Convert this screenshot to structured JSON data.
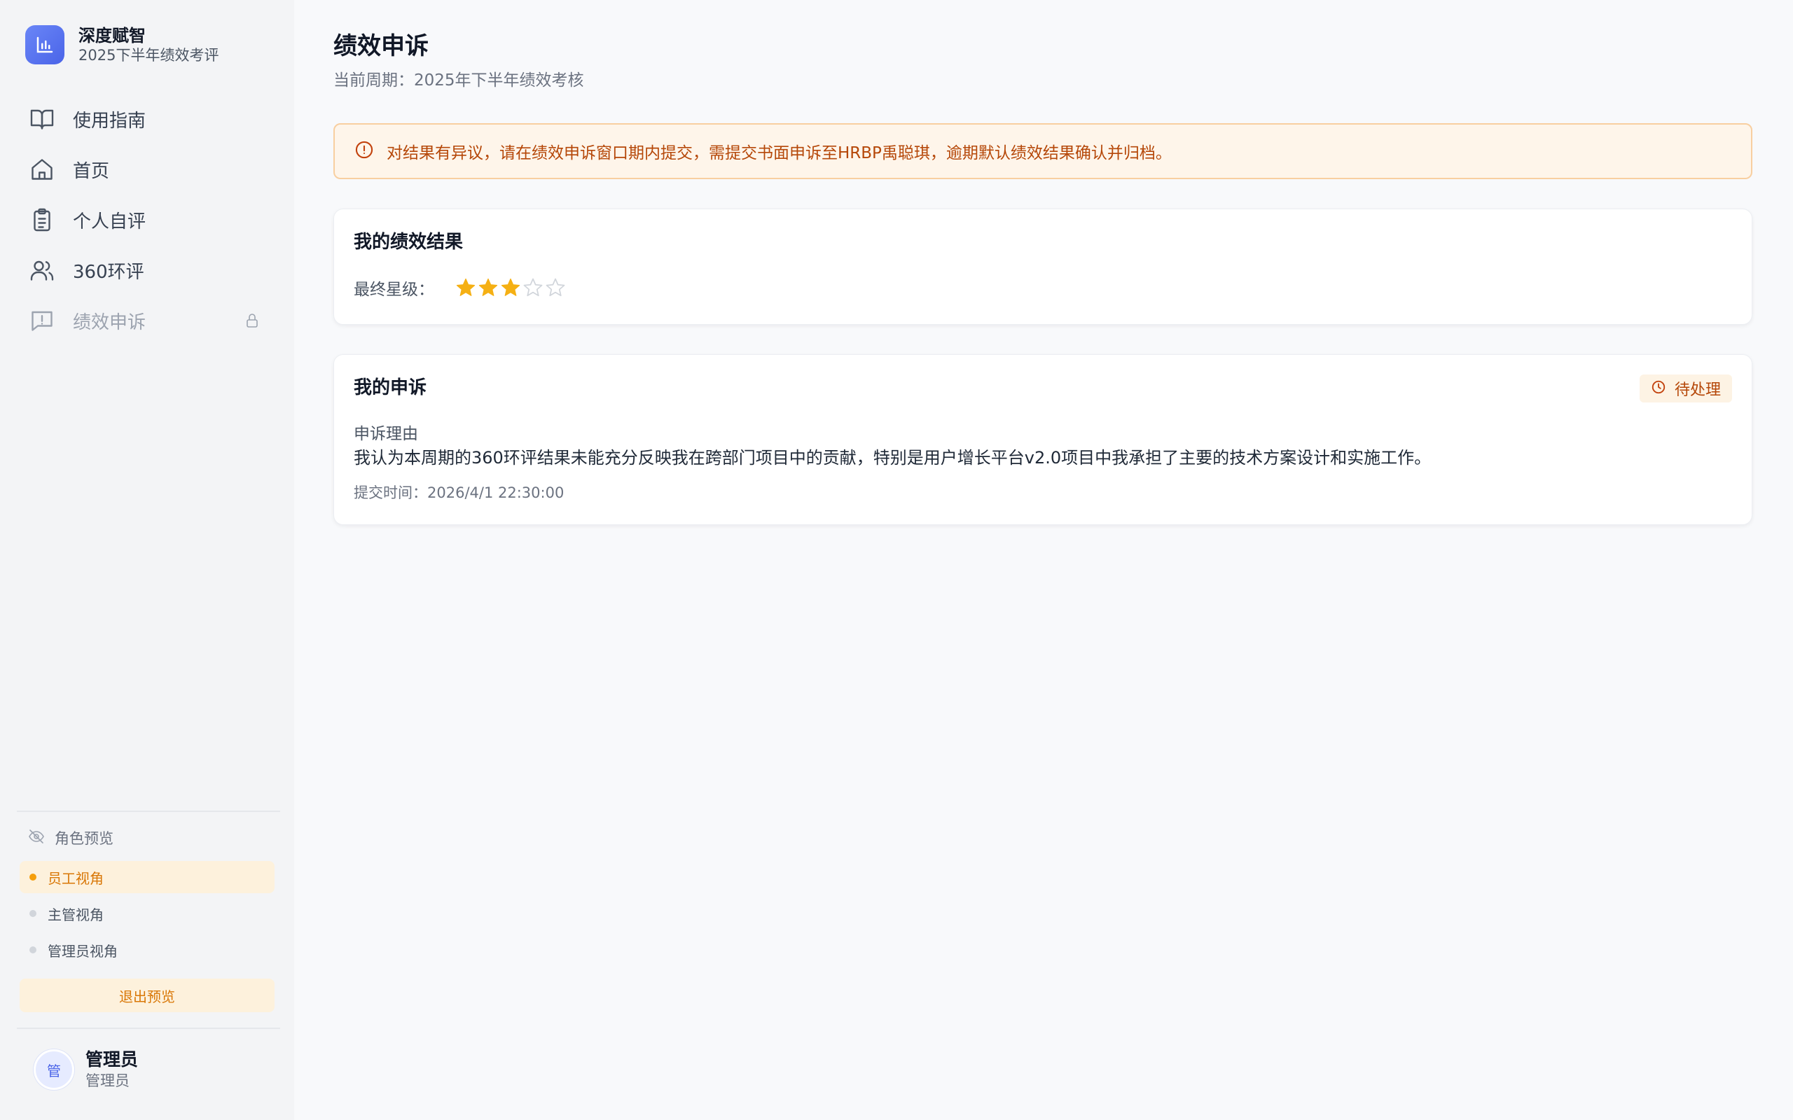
{
  "brand": {
    "name": "深度赋智",
    "cycle": "2025下半年绩效考评",
    "logo_icon": "bar-chart-icon",
    "accent": "#4a64e8"
  },
  "nav": {
    "items": [
      {
        "label": "使用指南",
        "icon": "book-open-icon"
      },
      {
        "label": "首页",
        "icon": "home-icon"
      },
      {
        "label": "个人自评",
        "icon": "clipboard-icon"
      },
      {
        "label": "360环评",
        "icon": "users-icon"
      },
      {
        "label": "绩效申诉",
        "icon": "message-alert-icon",
        "disabled": true,
        "locked": true
      }
    ]
  },
  "role_preview": {
    "title": "角色预览",
    "icon": "eye-off-icon",
    "options": [
      {
        "label": "员工视角",
        "active": true
      },
      {
        "label": "主管视角",
        "active": false
      },
      {
        "label": "管理员视角",
        "active": false
      }
    ],
    "exit_label": "退出预览",
    "highlight_color": "#f59e0b"
  },
  "user": {
    "avatar_text": "管",
    "name": "管理员",
    "role": "管理员"
  },
  "page": {
    "title": "绩效申诉",
    "subtitle": "当前周期：2025年下半年绩效考核"
  },
  "alert": {
    "icon": "alert-circle-icon",
    "text": "对结果有异议，请在绩效申诉窗口期内提交，需提交书面申诉至HRBP禹聪琪，逾期默认绩效结果确认并归档。",
    "color": "#b54708"
  },
  "result_card": {
    "title": "我的绩效结果",
    "rating_label": "最终星级：",
    "rating": 3,
    "rating_max": 5,
    "star_color": "#f5b014"
  },
  "appeal_card": {
    "title": "我的申诉",
    "status": "待处理",
    "status_icon": "clock-icon",
    "reason_label": "申诉理由",
    "reason_text": "我认为本周期的360环评结果未能充分反映我在跨部门项目中的贡献，特别是用户增长平台v2.0项目中我承担了主要的技术方案设计和实施工作。",
    "submit_time": "提交时间：2026/4/1 22:30:00"
  }
}
